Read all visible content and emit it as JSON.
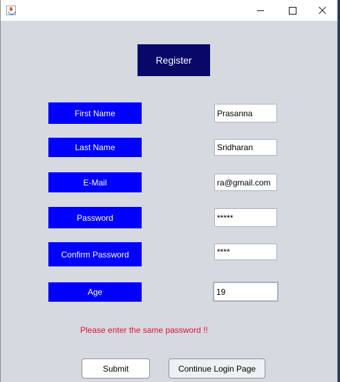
{
  "window": {
    "app_icon": "java-cup-icon",
    "controls": {
      "minimize_icon": "minimize-icon",
      "maximize_icon": "maximize-icon",
      "close_icon": "close-icon"
    }
  },
  "form": {
    "heading": "Register",
    "fields": {
      "first_name": {
        "label": "First Name",
        "value": "Prasanna"
      },
      "last_name": {
        "label": "Last Name",
        "value": "Sridharan"
      },
      "email": {
        "label": "E-Mail",
        "value": "ra@gmail.com"
      },
      "password": {
        "label": "Password",
        "value": "*****"
      },
      "confirm_password": {
        "label": "Confirm Password",
        "value": "****"
      },
      "age": {
        "label": "Age",
        "value": "19"
      }
    },
    "error_message": "Please enter the same password !!",
    "buttons": {
      "submit": "Submit",
      "continue_login": "Continue Login Page"
    }
  },
  "colors": {
    "heading_bg": "#080868",
    "label_bg": "#0000ff",
    "label_text": "#ffffff",
    "error_text": "#e0103a",
    "window_bg": "#d6d9e0"
  }
}
